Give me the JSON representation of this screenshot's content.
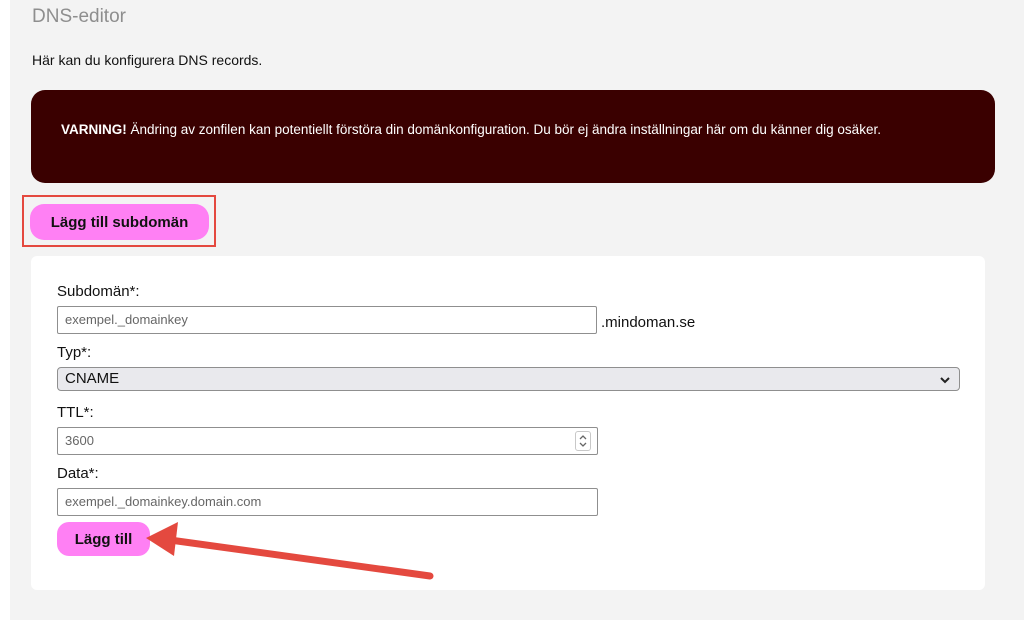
{
  "page": {
    "title": "DNS-editor",
    "intro": "Här kan du konfigurera DNS records."
  },
  "warning": {
    "label": "VARNING!",
    "text": " Ändring av zonfilen kan potentiellt förstöra din domänkonfiguration. Du bör ej ändra inställningar här om du känner dig osäker."
  },
  "buttons": {
    "add_subdomain": "Lägg till subdomän",
    "add": "Lägg till"
  },
  "form": {
    "subdomain": {
      "label": "Subdomän*:",
      "value": "exempel._domainkey",
      "suffix": ".mindoman.se"
    },
    "type": {
      "label": "Typ*:",
      "selected": "CNAME"
    },
    "ttl": {
      "label": "TTL*:",
      "value": "3600"
    },
    "data": {
      "label": "Data*:",
      "value": "exempel._domainkey.domain.com"
    }
  },
  "icons": {
    "select_arrow": "chevron-down-icon",
    "number_spinner": "spinner-icon"
  },
  "colors": {
    "warning_bg": "#3a0000",
    "button_pink": "#ff80f4",
    "annotation_red": "#e4493f"
  }
}
